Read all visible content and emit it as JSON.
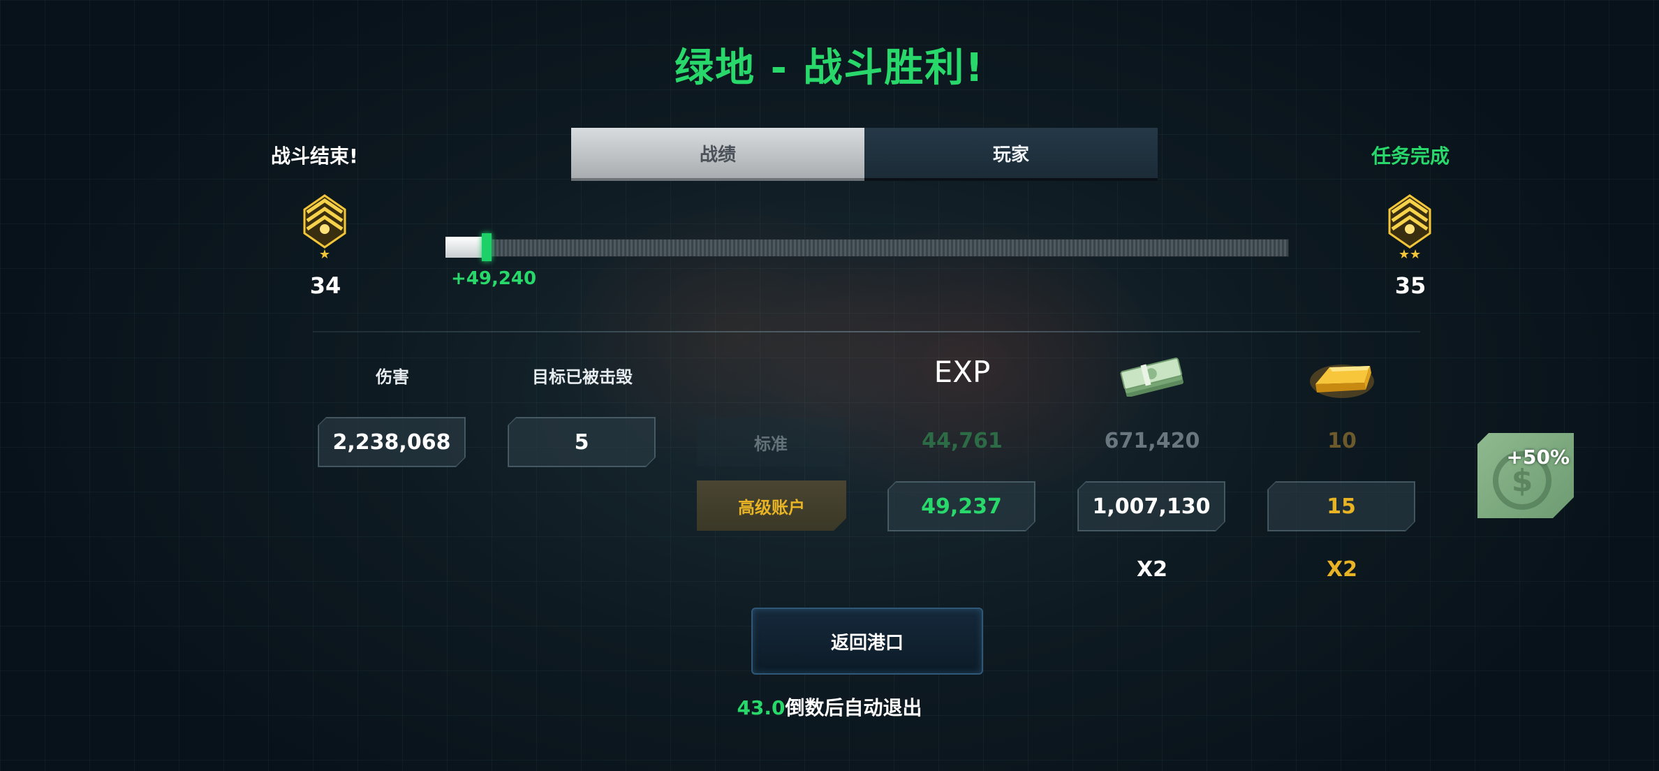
{
  "title": "绿地 - 战斗胜利!",
  "left_header": "战斗结束!",
  "right_header": "任务完成",
  "tabs": [
    "战绩",
    "玩家"
  ],
  "rank": {
    "current_level": "34",
    "next_level": "35",
    "xp_gain": "+49,240",
    "progress_fraction": 0.04
  },
  "stats": {
    "damage_label": "伤害",
    "damage_value": "2,238,068",
    "destroyed_label": "目标已被击毁",
    "destroyed_value": "5"
  },
  "rewards": {
    "exp_label": "EXP",
    "standard_label": "标准",
    "premium_label": "高级账户",
    "standard": {
      "exp": "44,761",
      "money": "671,420",
      "gold": "10"
    },
    "premium": {
      "exp": "49,237",
      "money": "1,007,130",
      "gold": "15"
    },
    "multipliers": {
      "money": "X2",
      "gold": "X2"
    }
  },
  "bonus_badge": "+50%",
  "return_button": "返回港口",
  "countdown": {
    "seconds": "43.0",
    "text": "倒数后自动退出"
  },
  "colors": {
    "accent_green": "#28d86a",
    "gold": "#e8b425"
  },
  "icons": [
    "rank-sergeant-icon",
    "cash-stack-icon",
    "gold-bar-icon",
    "dollar-coin-icon"
  ]
}
